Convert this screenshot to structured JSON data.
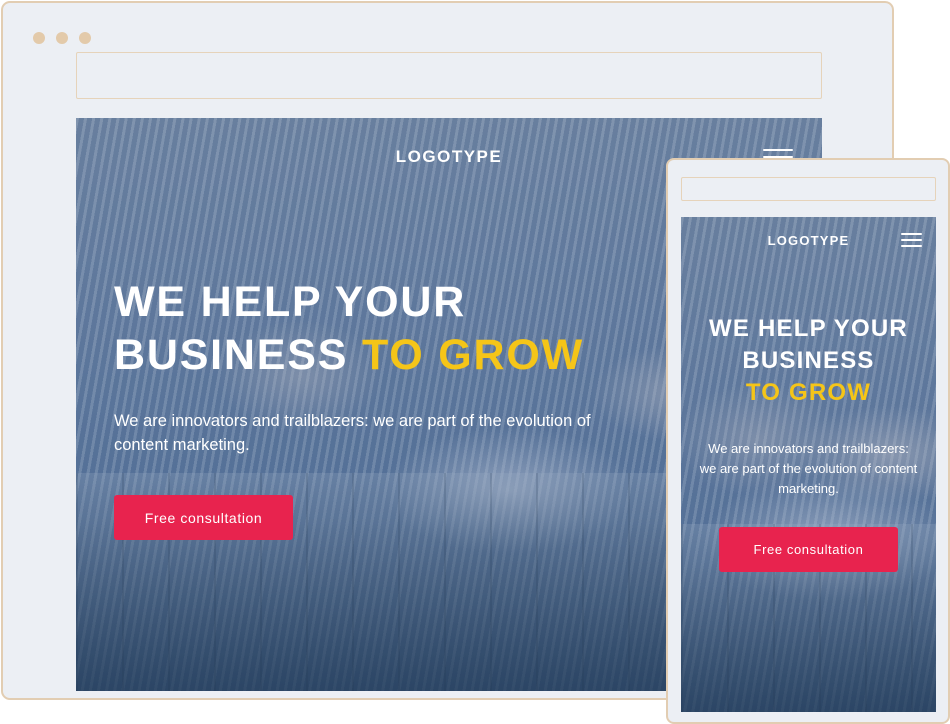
{
  "colors": {
    "frame_border": "#e2cdb2",
    "frame_bg": "#eceff4",
    "accent": "#f5c518",
    "button": "#e8234e",
    "text": "#ffffff"
  },
  "desktop": {
    "logo": "LOGOTYPE",
    "menu_icon": "hamburger-menu-icon",
    "headline_line1": "WE HELP YOUR",
    "headline_line2_plain": "BUSINESS ",
    "headline_line2_accent": "TO GROW",
    "subtitle": "We are innovators and trailblazers: we are part of the evolution of content marketing.",
    "cta_label": "Free consultation"
  },
  "mobile": {
    "logo": "LOGOTYPE",
    "menu_icon": "hamburger-menu-icon",
    "headline_line1": "WE HELP YOUR",
    "headline_line2": "BUSINESS",
    "headline_line3_accent": "TO GROW",
    "subtitle": "We are innovators and trailblazers: we are part of the evolution of content marketing.",
    "cta_label": "Free consultation"
  }
}
